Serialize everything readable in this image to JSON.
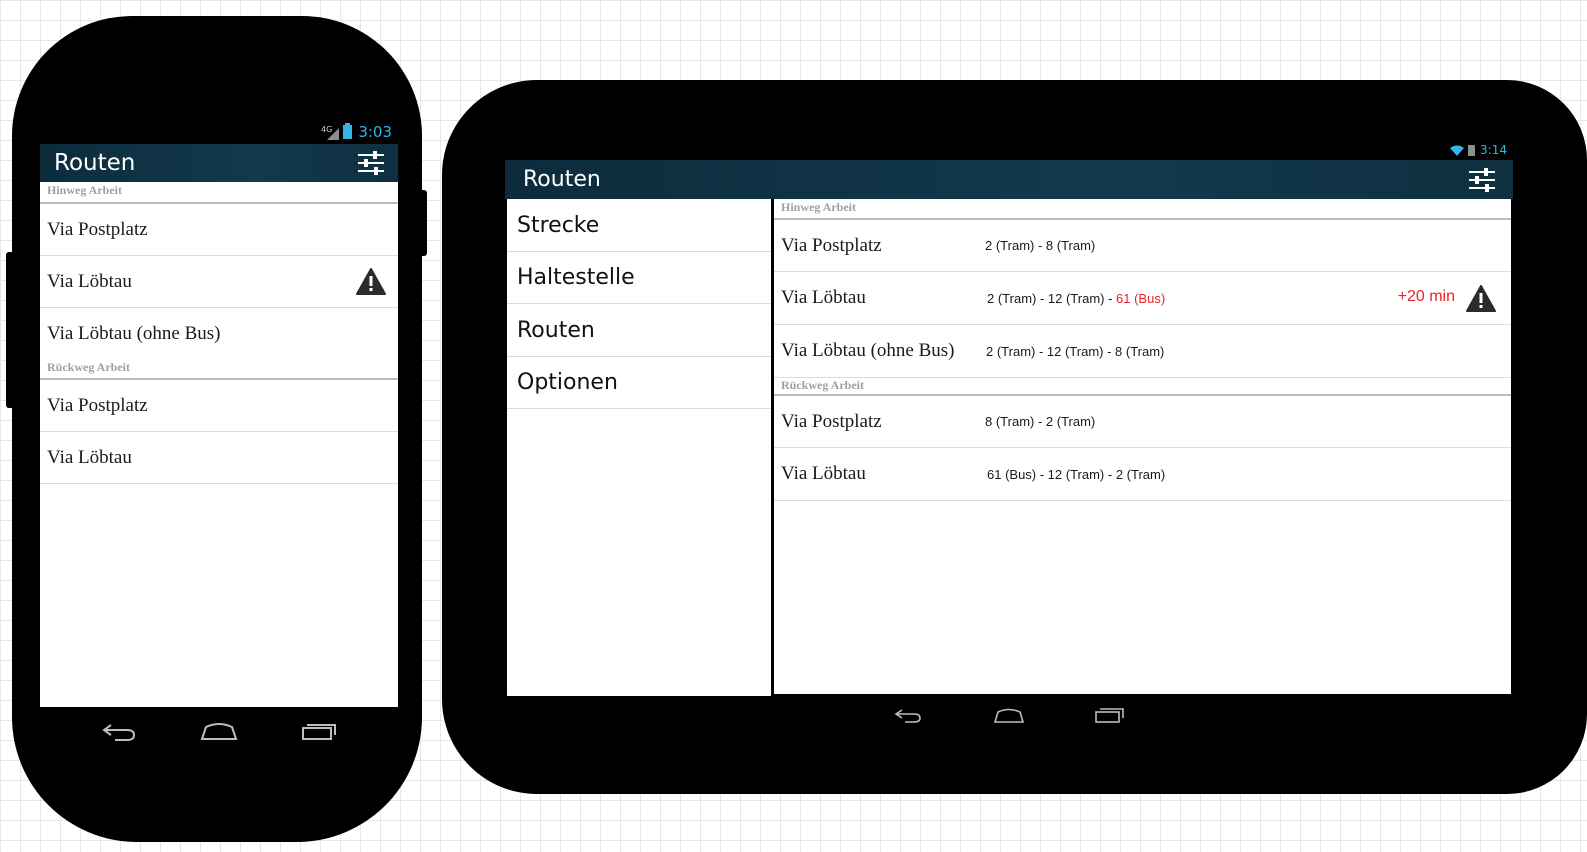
{
  "phone": {
    "status": {
      "network": "4G",
      "time": "3:03"
    },
    "actionbar": {
      "title": "Routen",
      "filter_icon": "sliders-icon"
    },
    "sections": [
      {
        "header": "Hinweg Arbeit",
        "rows": [
          {
            "label": "Via Postplatz",
            "warning": false
          },
          {
            "label": "Via Löbtau",
            "warning": true
          },
          {
            "label": "Via Löbtau (ohne Bus)",
            "warning": false
          }
        ]
      },
      {
        "header": "Rückweg Arbeit",
        "rows": [
          {
            "label": "Via Postplatz",
            "warning": false
          },
          {
            "label": "Via Löbtau",
            "warning": false
          }
        ]
      }
    ],
    "navbar": {
      "back": "back-icon",
      "home": "home-icon",
      "recent": "recent-apps-icon"
    }
  },
  "tablet": {
    "status": {
      "time": "3:14"
    },
    "actionbar": {
      "title": "Routen",
      "filter_icon": "sliders-icon"
    },
    "menu": [
      "Strecke",
      "Haltestelle",
      "Routen",
      "Optionen"
    ],
    "sections": [
      {
        "header": "Hinweg Arbeit",
        "rows": [
          {
            "label": "Via Postplatz",
            "route": "2 (Tram) - 8 (Tram)",
            "route_red": "",
            "delay": ""
          },
          {
            "label": "Via Löbtau",
            "route": "2 (Tram) - 12 (Tram) - ",
            "route_red": "61 (Bus)",
            "delay": "+20 min"
          },
          {
            "label": "Via Löbtau (ohne Bus)",
            "route": "2 (Tram) - 12 (Tram) - 8 (Tram)",
            "route_red": "",
            "delay": ""
          }
        ]
      },
      {
        "header": "Rückweg Arbeit",
        "rows": [
          {
            "label": "Via Postplatz",
            "route": "8 (Tram) - 2 (Tram)",
            "route_red": "",
            "delay": ""
          },
          {
            "label": "Via Löbtau",
            "route": "61 (Bus) - 12 (Tram) - 2 (Tram)",
            "route_red": "",
            "delay": ""
          }
        ]
      }
    ],
    "navbar": {
      "back": "back-icon",
      "home": "home-icon",
      "recent": "recent-apps-icon"
    }
  },
  "colors": {
    "accent": "#33b5e5",
    "actionbar": "#12394d",
    "alert": "#e8232a"
  }
}
